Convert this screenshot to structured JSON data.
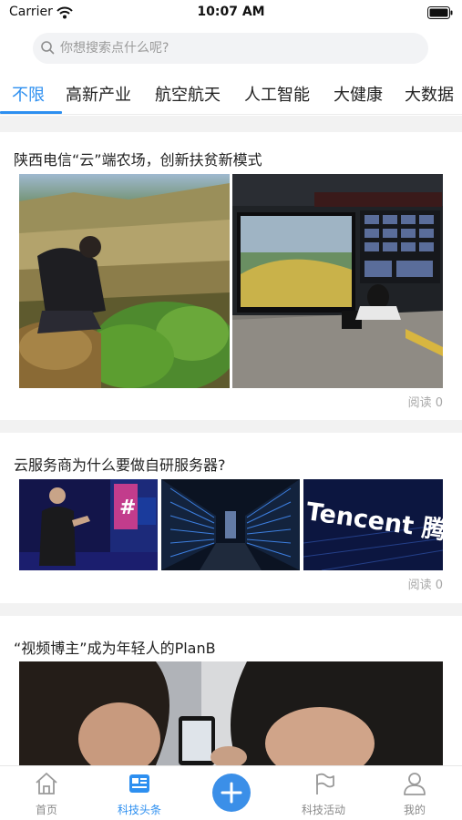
{
  "status_bar": {
    "carrier": "Carrier",
    "time": "10:07 AM"
  },
  "search": {
    "placeholder": "你想搜索点什么呢?"
  },
  "category_tabs": [
    {
      "label": "不限",
      "active": true
    },
    {
      "label": "高新产业",
      "active": false
    },
    {
      "label": "航空航天",
      "active": false
    },
    {
      "label": "人工智能",
      "active": false
    },
    {
      "label": "大健康",
      "active": false
    },
    {
      "label": "大数据",
      "active": false
    }
  ],
  "articles": [
    {
      "title": "陕西电信“云”端农场，创新扶贫新模式",
      "read_text": "阅读 0"
    },
    {
      "title": "云服务商为什么要做自研服务器?",
      "read_text": "阅读 0"
    },
    {
      "title": "“视频博主”成为年轻人的PlanB"
    }
  ],
  "image_texts": {
    "tencent_logo": "Tencent 腾"
  },
  "bottom_nav": [
    {
      "label": "首页",
      "icon": "home-icon",
      "active": false
    },
    {
      "label": "科技头条",
      "icon": "news-icon",
      "active": true
    },
    {
      "label": "",
      "icon": "plus-icon",
      "active": false
    },
    {
      "label": "科技活动",
      "icon": "flag-icon",
      "active": false
    },
    {
      "label": "我的",
      "icon": "user-icon",
      "active": false
    }
  ],
  "colors": {
    "accent": "#2d8ff0",
    "plus_button": "#3b8fe8",
    "muted_text": "#8a8a8a",
    "divider": "#f2f2f2"
  }
}
